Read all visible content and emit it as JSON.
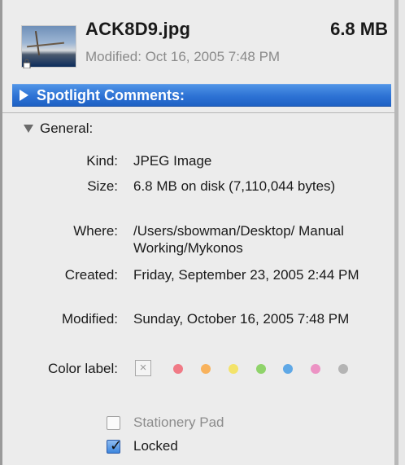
{
  "file": {
    "name": "ACK8D9.jpg",
    "size": "6.8 MB",
    "modified_summary": "Modified: Oct 16, 2005 7:48 PM"
  },
  "spotlight": {
    "label": "Spotlight Comments:"
  },
  "general": {
    "label": "General:",
    "rows": [
      {
        "label": "Kind:",
        "value": "JPEG Image"
      },
      {
        "label": "Size:",
        "value": "6.8 MB on disk (7,110,044 bytes)"
      },
      {
        "label": "Where:",
        "value": "/Users/sbowman/Desktop/ Manual Working/Mykonos"
      },
      {
        "label": "Created:",
        "value": "Friday, September 23, 2005 2:44 PM"
      },
      {
        "label": "Modified:",
        "value": "Sunday, October 16, 2005 7:48 PM"
      }
    ],
    "color_label": {
      "label": "Color label:",
      "none_glyph": "×",
      "swatches": [
        {
          "name": "red",
          "color": "#f07a86"
        },
        {
          "name": "orange",
          "color": "#f8b25c"
        },
        {
          "name": "yellow",
          "color": "#f3e36a"
        },
        {
          "name": "green",
          "color": "#8fd36a"
        },
        {
          "name": "blue",
          "color": "#5fa8e6"
        },
        {
          "name": "purple",
          "color": "#ec93c4"
        },
        {
          "name": "gray",
          "color": "#b4b4b4"
        }
      ]
    },
    "stationery_pad": {
      "label": "Stationery Pad",
      "checked": false
    },
    "locked": {
      "label": "Locked",
      "checked": true
    }
  },
  "colors": {
    "spotlight_bar": "#2d72d4",
    "panel_bg": "#ececec"
  }
}
